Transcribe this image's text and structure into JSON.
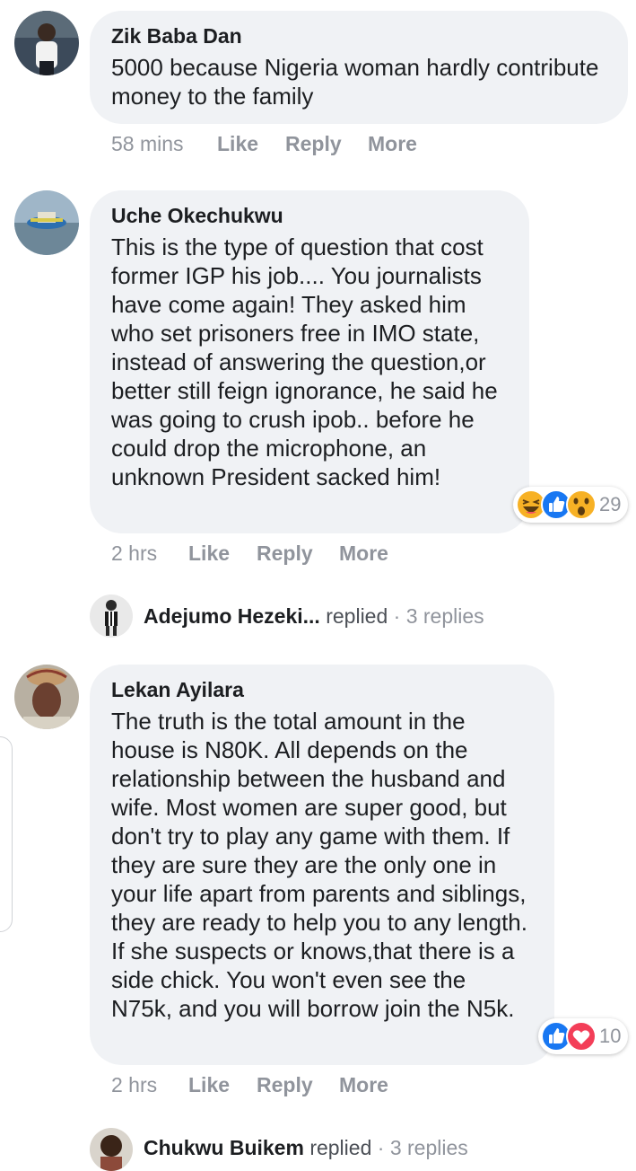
{
  "comments": [
    {
      "author": "Zik Baba Dan",
      "text": "5000 because Nigeria woman hardly contribute money to the family",
      "time": "58 mins",
      "like": "Like",
      "reply": "Reply",
      "more": "More"
    },
    {
      "author": "Uche Okechukwu",
      "text": "This is the type of question that cost former IGP his job.... You journalists have come again! They asked him who set prisoners free in IMO state, instead of answering the question,or better still feign ignorance, he said he was going to crush ipob.. before he could drop the microphone, an unknown President sacked him!",
      "time": "2 hrs",
      "like": "Like",
      "reply": "Reply",
      "more": "More",
      "reaction_count": "29",
      "reactions": [
        "haha-icon",
        "like-icon",
        "wow-icon"
      ],
      "replies": {
        "name": "Adejumo Hezeki...",
        "verb": "replied",
        "sep": "·",
        "count": "3 replies"
      }
    },
    {
      "author": "Lekan Ayilara",
      "text": "The truth is the total amount in the house is N80K. All depends on the relationship between the husband and wife. Most women are super good, but don't try to play any game with them. If they are sure they are the only one in your life apart from parents and siblings, they are ready to help you to any length. If she suspects or knows,that there is a side chick. You won't even see the N75k, and you will borrow join the N5k.",
      "time": "2 hrs",
      "like": "Like",
      "reply": "Reply",
      "more": "More",
      "reaction_count": "10",
      "reactions": [
        "like-icon",
        "love-icon"
      ],
      "replies": {
        "name": "Chukwu Buikem",
        "verb": "replied",
        "sep": "·",
        "count": "3 replies"
      }
    }
  ],
  "colors": {
    "bubble": "#f0f2f5",
    "meta": "#90949c",
    "like_blue": "#1877f2",
    "love_red": "#f33e58",
    "emoji_yellow": "#f7b125"
  }
}
